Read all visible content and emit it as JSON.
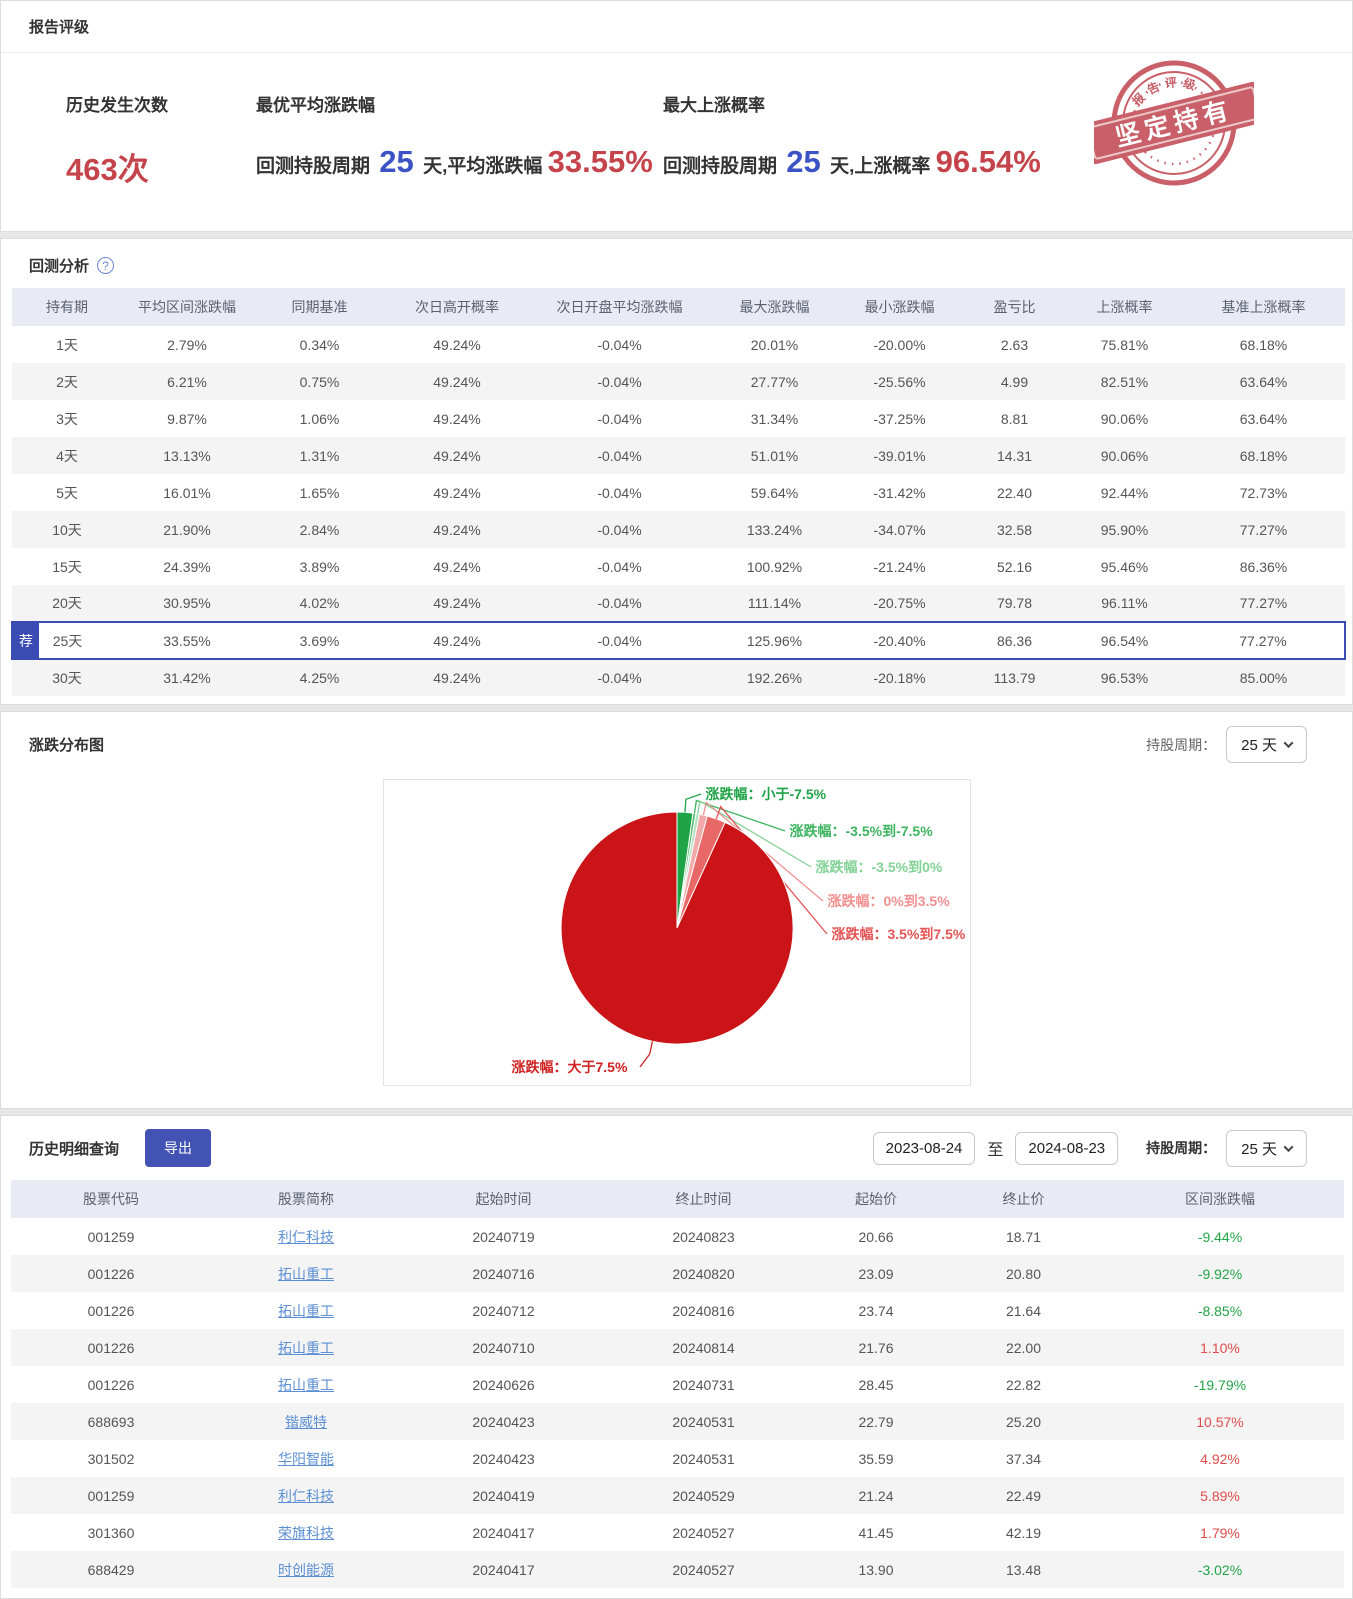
{
  "colors": {
    "accent_red": "#c5434b",
    "accent_blue": "#3b53c4",
    "indigo": "#3a4cb4",
    "link_blue": "#5c8fd3",
    "positive_red": "#e14b4b",
    "negative_green": "#21a447",
    "stamp_red": "#c24b55"
  },
  "rating": {
    "section_title": "报告评级",
    "stat1": {
      "label": "历史发生次数",
      "value": "463次"
    },
    "stat2": {
      "label": "最优平均涨跌幅",
      "prefix": "回测持股周期",
      "days": "25",
      "middle": "天,平均涨跌幅",
      "value": "33.55%"
    },
    "stat3": {
      "label": "最大上涨概率",
      "prefix": "回测持股周期",
      "days": "25",
      "middle": "天,上涨概率",
      "value": "96.54%"
    },
    "stamp": {
      "banner": "坚定持有",
      "arc": "报告评级"
    }
  },
  "backtest": {
    "section_title": "回测分析",
    "help_icon": "?",
    "columns": [
      "持有期",
      "平均区间涨跌幅",
      "同期基准",
      "次日高开概率",
      "次日开盘平均涨跌幅",
      "最大涨跌幅",
      "最小涨跌幅",
      "盈亏比",
      "上涨概率",
      "基准上涨概率"
    ],
    "recommend_badge": "荐",
    "highlighted_row": 8,
    "rows": [
      [
        "1天",
        "2.79%",
        "0.34%",
        "49.24%",
        "-0.04%",
        "20.01%",
        "-20.00%",
        "2.63",
        "75.81%",
        "68.18%"
      ],
      [
        "2天",
        "6.21%",
        "0.75%",
        "49.24%",
        "-0.04%",
        "27.77%",
        "-25.56%",
        "4.99",
        "82.51%",
        "63.64%"
      ],
      [
        "3天",
        "9.87%",
        "1.06%",
        "49.24%",
        "-0.04%",
        "31.34%",
        "-37.25%",
        "8.81",
        "90.06%",
        "63.64%"
      ],
      [
        "4天",
        "13.13%",
        "1.31%",
        "49.24%",
        "-0.04%",
        "51.01%",
        "-39.01%",
        "14.31",
        "90.06%",
        "68.18%"
      ],
      [
        "5天",
        "16.01%",
        "1.65%",
        "49.24%",
        "-0.04%",
        "59.64%",
        "-31.42%",
        "22.40",
        "92.44%",
        "72.73%"
      ],
      [
        "10天",
        "21.90%",
        "2.84%",
        "49.24%",
        "-0.04%",
        "133.24%",
        "-34.07%",
        "32.58",
        "95.90%",
        "77.27%"
      ],
      [
        "15天",
        "24.39%",
        "3.89%",
        "49.24%",
        "-0.04%",
        "100.92%",
        "-21.24%",
        "52.16",
        "95.46%",
        "86.36%"
      ],
      [
        "20天",
        "30.95%",
        "4.02%",
        "49.24%",
        "-0.04%",
        "111.14%",
        "-20.75%",
        "79.78",
        "96.11%",
        "77.27%"
      ],
      [
        "25天",
        "33.55%",
        "3.69%",
        "49.24%",
        "-0.04%",
        "125.96%",
        "-20.40%",
        "86.36",
        "96.54%",
        "77.27%"
      ],
      [
        "30天",
        "31.42%",
        "4.25%",
        "49.24%",
        "-0.04%",
        "192.26%",
        "-20.18%",
        "113.79",
        "96.53%",
        "85.00%"
      ]
    ]
  },
  "distribution": {
    "section_title": "涨跌分布图",
    "period_label": "持股周期：",
    "period_value": "25 天"
  },
  "chart_data": {
    "type": "pie",
    "title": "涨跌分布图",
    "labels": [
      "涨跌幅：小于-7.5%",
      "涨跌幅：-3.5%到-7.5%",
      "涨跌幅：-3.5%到0%",
      "涨跌幅：0%到3.5%",
      "涨跌幅：3.5%到7.5%",
      "涨跌幅：大于7.5%"
    ],
    "values": [
      2.2,
      0.4,
      0.5,
      1.1,
      2.6,
      93.2
    ],
    "colors": [
      "#1fa347",
      "#55bf70",
      "#b5e3c2",
      "#f2a9a9",
      "#e86868",
      "#cb1417"
    ],
    "label_colors": [
      "#1fa347",
      "#3db45f",
      "#82d295",
      "#f19090",
      "#e45454",
      "#d02222"
    ],
    "start_angle_deg": 0,
    "direction": "clockwise",
    "legend_position": "labels-with-leader-lines"
  },
  "history": {
    "section_title": "历史明细查询",
    "export_label": "导出",
    "date_from": "2023-08-24",
    "date_separator": "至",
    "date_to": "2024-08-23",
    "period_label": "持股周期：",
    "period_value": "25 天",
    "columns": [
      "股票代码",
      "股票简称",
      "起始时间",
      "终止时间",
      "起始价",
      "终止价",
      "区间涨跌幅"
    ],
    "rows": [
      [
        "001259",
        "利仁科技",
        "20240719",
        "20240823",
        "20.66",
        "18.71",
        "-9.44%"
      ],
      [
        "001226",
        "拓山重工",
        "20240716",
        "20240820",
        "23.09",
        "20.80",
        "-9.92%"
      ],
      [
        "001226",
        "拓山重工",
        "20240712",
        "20240816",
        "23.74",
        "21.64",
        "-8.85%"
      ],
      [
        "001226",
        "拓山重工",
        "20240710",
        "20240814",
        "21.76",
        "22.00",
        "1.10%"
      ],
      [
        "001226",
        "拓山重工",
        "20240626",
        "20240731",
        "28.45",
        "22.82",
        "-19.79%"
      ],
      [
        "688693",
        "锴威特",
        "20240423",
        "20240531",
        "22.79",
        "25.20",
        "10.57%"
      ],
      [
        "301502",
        "华阳智能",
        "20240423",
        "20240531",
        "35.59",
        "37.34",
        "4.92%"
      ],
      [
        "001259",
        "利仁科技",
        "20240419",
        "20240529",
        "21.24",
        "22.49",
        "5.89%"
      ],
      [
        "301360",
        "荣旗科技",
        "20240417",
        "20240527",
        "41.45",
        "42.19",
        "1.79%"
      ],
      [
        "688429",
        "时创能源",
        "20240417",
        "20240527",
        "13.90",
        "13.48",
        "-3.02%"
      ]
    ]
  }
}
